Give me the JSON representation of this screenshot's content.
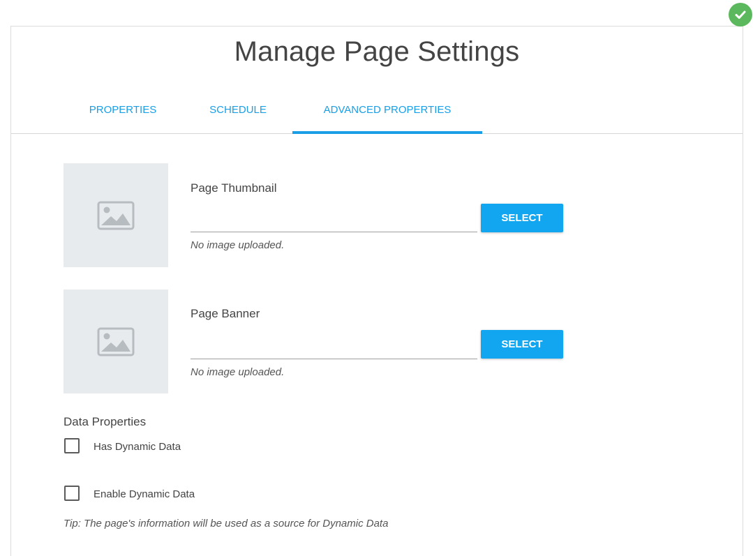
{
  "header": {
    "title": "Manage Page Settings"
  },
  "status": {
    "icon": "check-circle-icon",
    "color": "#5cb85c"
  },
  "tabs": [
    {
      "label": "PROPERTIES",
      "active": false
    },
    {
      "label": "SCHEDULE",
      "active": false
    },
    {
      "label": "ADVANCED PROPERTIES",
      "active": true
    }
  ],
  "images": {
    "thumbnail": {
      "label": "Page Thumbnail",
      "button_label": "SELECT",
      "status_text": "No image uploaded.",
      "placeholder_icon": "image-placeholder-icon"
    },
    "banner": {
      "label": "Page Banner",
      "button_label": "SELECT",
      "status_text": "No image uploaded.",
      "placeholder_icon": "image-placeholder-icon"
    }
  },
  "data_properties": {
    "heading": "Data Properties",
    "has_dynamic_data": {
      "label": "Has Dynamic Data",
      "checked": false
    },
    "enable_dynamic_data": {
      "label": "Enable Dynamic Data",
      "checked": false
    },
    "tip": "Tip: The page's information will be used as a source for Dynamic Data"
  },
  "colors": {
    "accent": "#1a9ee6",
    "button": "#12a6f0",
    "placeholder_bg": "#e8ebee"
  }
}
